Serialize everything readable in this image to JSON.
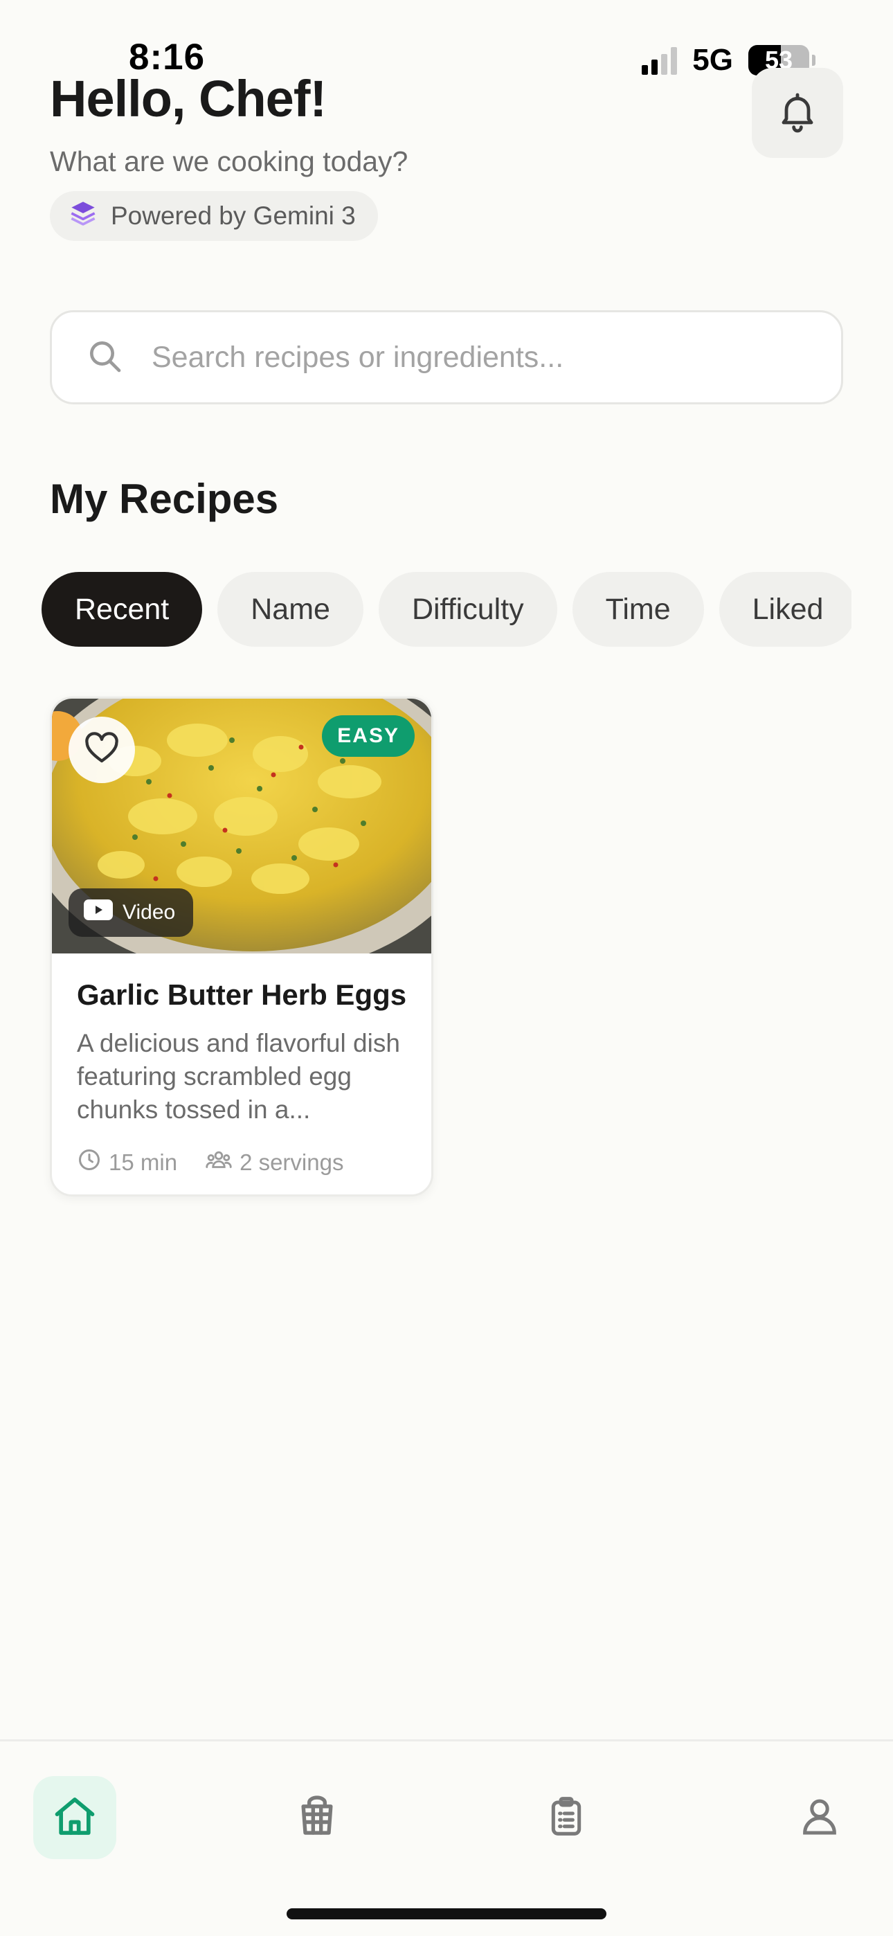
{
  "status_bar": {
    "time": "8:16",
    "network": "5G",
    "battery": "53",
    "battery_level": 0.53
  },
  "header": {
    "greeting": "Hello, Chef!",
    "subtitle": "What are we cooking today?",
    "powered_by": "Powered by Gemini 3",
    "powered_icon": "layers-icon",
    "notification_icon": "bell-icon"
  },
  "search": {
    "placeholder": "Search recipes or ingredients...",
    "icon": "search-icon"
  },
  "section": {
    "title": "My Recipes"
  },
  "filters": {
    "items": [
      "Recent",
      "Name",
      "Difficulty",
      "Time",
      "Liked"
    ],
    "active": "Recent"
  },
  "recipes": [
    {
      "title": "Garlic Butter Herb Eggs",
      "description": "A delicious and flavorful dish featuring scrambled egg chunks tossed in a...",
      "difficulty": "EASY",
      "media_label": "Video",
      "time": "15 min",
      "servings": "2 servings",
      "favorite_icon": "heart-outline-icon"
    }
  ],
  "bottom_nav": {
    "items": [
      "home-icon",
      "recipe-cart-icon",
      "clipboard-list-icon",
      "profile-icon"
    ],
    "active": "home-icon"
  },
  "colors": {
    "background": "#fbfbf8",
    "accent_green": "#0f9d6e",
    "active_chip": "#1c1917",
    "powered_icon": "#7c4ddb"
  }
}
